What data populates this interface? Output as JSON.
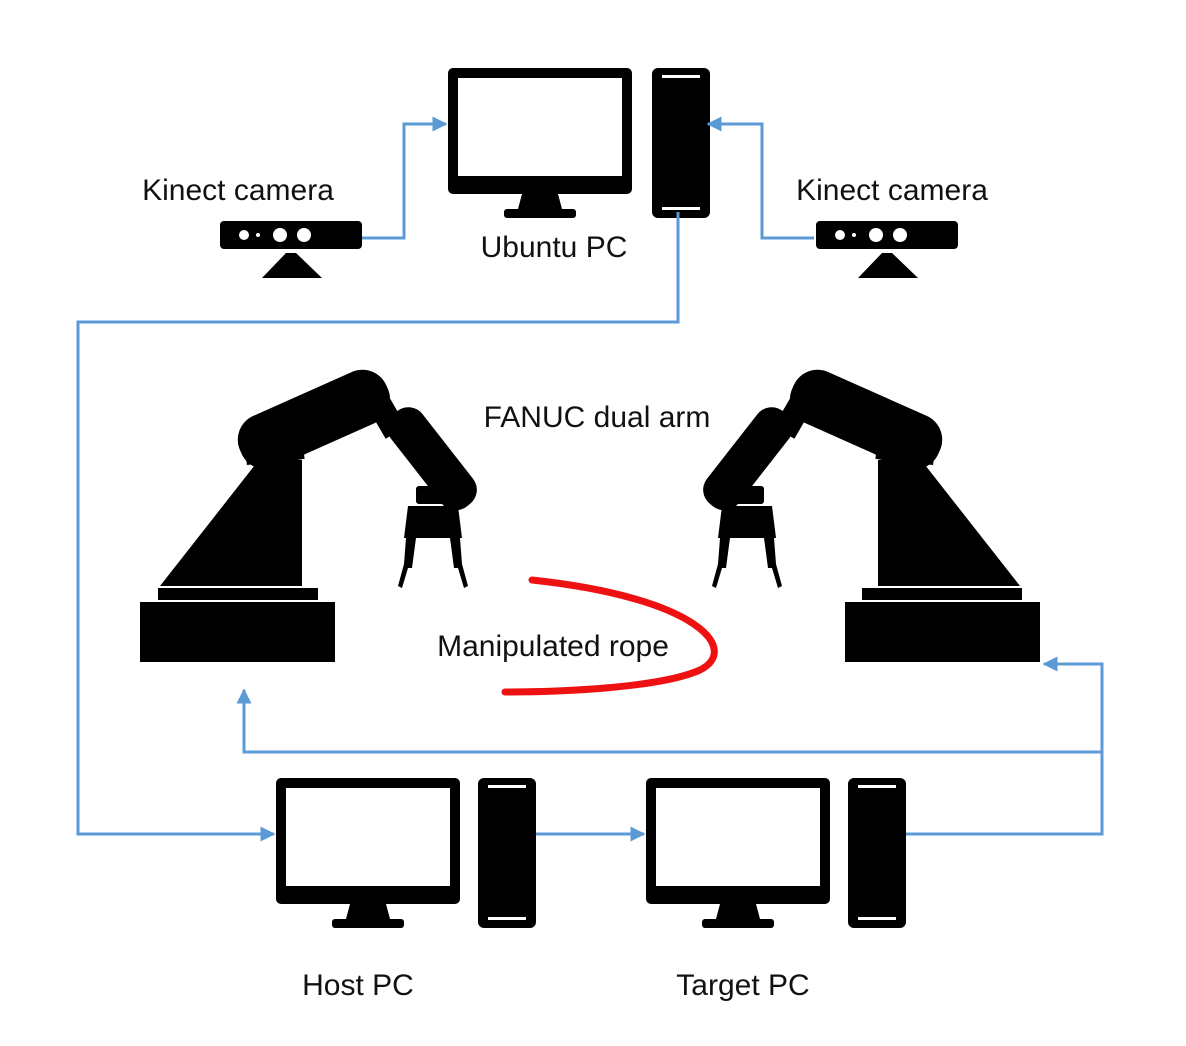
{
  "labels": {
    "kinect_left": "Kinect camera",
    "kinect_right": "Kinect camera",
    "ubuntu_pc": "Ubuntu PC",
    "fanuc": "FANUC dual arm",
    "rope": "Manipulated rope",
    "host_pc": "Host PC",
    "target_pc": "Target PC"
  },
  "colors": {
    "connector": "#5b9bd5",
    "rope": "#ee1111",
    "device": "#000000"
  },
  "icons": {
    "kinect": "kinect-camera-icon",
    "monitor": "monitor-icon",
    "tower": "pc-tower-icon",
    "robot": "robot-arm-icon"
  }
}
